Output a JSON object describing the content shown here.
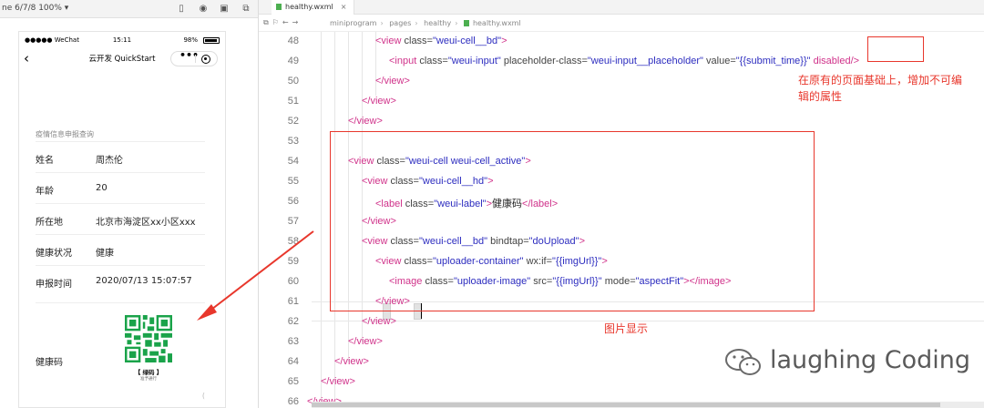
{
  "simulator": {
    "device_label": "ne 6/7/8 100% ▾",
    "status_bar": {
      "carrier": "●●●●● WeChat",
      "time": "15:11",
      "battery": "98%"
    },
    "nav": {
      "back_glyph": "‹",
      "title": "云开发 QuickStart",
      "capsule_dots": "•••"
    },
    "section_title": "疫情信息申报查询",
    "fields": [
      {
        "label": "姓名",
        "value": "周杰伦"
      },
      {
        "label": "年龄",
        "value": "20"
      },
      {
        "label": "所在地",
        "value": "北京市海淀区xx小区xxx"
      },
      {
        "label": "健康状况",
        "value": "健康"
      },
      {
        "label": "申报时间",
        "value": "2020/07/13 15:07:57"
      }
    ],
    "qr": {
      "label": "健康码",
      "caption": "【 绿码 】",
      "sub": "准予通行",
      "color": "#1aa34a"
    },
    "scroll_mark": "("
  },
  "editor": {
    "tab_label": "healthy.wxml",
    "tab_close": "×",
    "breadcrumb": [
      "miniprogram",
      "pages",
      "healthy",
      "healthy.wxml"
    ],
    "lines": [
      {
        "n": 48,
        "indent": 3,
        "html": "<span class=\"tag\">&lt;view</span> <span class=\"attr\">class=</span><span class=\"str\">\"weui-cell__bd\"</span><span class=\"tag\">&gt;</span>"
      },
      {
        "n": 49,
        "indent": 4,
        "html": "<span class=\"tag\">&lt;input</span> <span class=\"attr\">class=</span><span class=\"str\">\"weui-input\"</span>  <span class=\"attr\">placeholder-class=</span><span class=\"str\">\"weui-input__placeholder\"</span> <span class=\"attr\">value=</span><span class=\"str\">\"{{submit_time}}\"</span> <span class=\"tag\">disabled/&gt;</span>"
      },
      {
        "n": 50,
        "indent": 3,
        "html": "<span class=\"tag\">&lt;/view&gt;</span>"
      },
      {
        "n": 51,
        "indent": 2,
        "html": "<span class=\"tag\">&lt;/view&gt;</span>"
      },
      {
        "n": 52,
        "indent": 1,
        "html": "<span class=\"tag\">&lt;/view&gt;</span>"
      },
      {
        "n": 53,
        "indent": 0,
        "html": ""
      },
      {
        "n": 54,
        "indent": 1,
        "html": "<span class=\"tag\">&lt;view</span> <span class=\"attr\">class=</span><span class=\"str\">\"weui-cell weui-cell_active\"</span><span class=\"tag\">&gt;</span>"
      },
      {
        "n": 55,
        "indent": 2,
        "html": "<span class=\"tag\">&lt;view</span> <span class=\"attr\">class=</span><span class=\"str\">\"weui-cell__hd\"</span><span class=\"tag\">&gt;</span>"
      },
      {
        "n": 56,
        "indent": 3,
        "html": "<span class=\"tag\">&lt;label</span> <span class=\"attr\">class=</span><span class=\"str\">\"weui-label\"</span><span class=\"tag\">&gt;</span><span class=\"txt\">健康码</span><span class=\"tag\">&lt;/label&gt;</span>"
      },
      {
        "n": 57,
        "indent": 2,
        "html": "<span class=\"tag\">&lt;/view&gt;</span>"
      },
      {
        "n": 58,
        "indent": 2,
        "html": "<span class=\"tag\">&lt;view</span> <span class=\"attr\">class=</span><span class=\"str\">\"weui-cell__bd\"</span> <span class=\"attr\">bindtap=</span><span class=\"str\">\"doUpload\"</span><span class=\"tag\">&gt;</span>"
      },
      {
        "n": 59,
        "indent": 3,
        "html": "<span class=\"tag\">&lt;view</span> <span class=\"attr\">class=</span><span class=\"str\">\"uploader-container\"</span> <span class=\"attr\">wx:if=</span><span class=\"str\">\"{{imgUrl}}\"</span><span class=\"tag\">&gt;</span>"
      },
      {
        "n": 60,
        "indent": 4,
        "html": "<span class=\"tag\">&lt;image</span> <span class=\"attr\">class=</span><span class=\"str\">\"uploader-image\"</span> <span class=\"attr\">src=</span><span class=\"str\">\"{{imgUrl}}\"</span> <span class=\"attr\">mode=</span><span class=\"str\">\"aspectFit\"</span><span class=\"tag\">&gt;&lt;/image&gt;</span>"
      },
      {
        "n": 61,
        "indent": 3,
        "html": "<span class=\"tag\">&lt;/view&gt;</span>"
      },
      {
        "n": 62,
        "indent": 2,
        "html": "<span class=\"tag\">&lt;/view&gt;</span>"
      },
      {
        "n": 63,
        "indent": 1,
        "html": "<span class=\"tag\">&lt;/view&gt;</span>"
      },
      {
        "n": 64,
        "indent": 0,
        "html": "<span class=\"tag\">&lt;/view&gt;</span>"
      },
      {
        "n": 65,
        "indent": -1,
        "html": "<span class=\"tag\">&lt;/view&gt;</span>"
      },
      {
        "n": 66,
        "indent": -2,
        "html": "<span class=\"tag\">&lt;/view&gt;</span>"
      }
    ]
  },
  "annotations": {
    "disabled_note_line1": "在原有的页面基础上，增加不可编",
    "disabled_note_line2": "辑的属性",
    "image_note": "图片显示",
    "color": "#e8372c"
  },
  "watermark": {
    "text": "laughing Coding",
    "icon": "wechat-icon"
  }
}
